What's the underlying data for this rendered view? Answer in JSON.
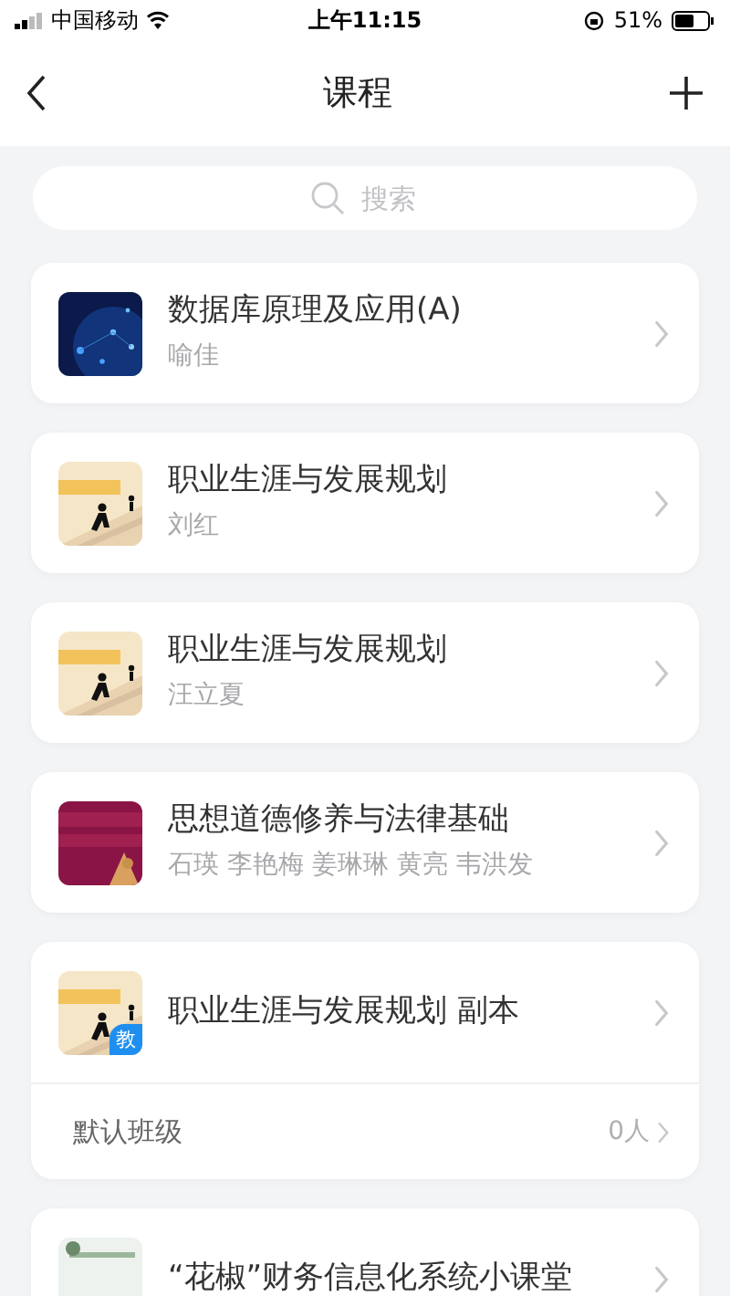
{
  "status_bar": {
    "carrier": "中国移动",
    "time": "上午11:15",
    "battery": "51%"
  },
  "nav": {
    "title": "课程"
  },
  "search": {
    "placeholder": "搜索"
  },
  "courses": [
    {
      "title": "数据库原理及应用(A)",
      "teachers": "喻佳"
    },
    {
      "title": "职业生涯与发展规划",
      "teachers": "刘红"
    },
    {
      "title": "职业生涯与发展规划",
      "teachers": "汪立夏"
    },
    {
      "title": "思想道德修养与法律基础",
      "teachers": "石瑛 李艳梅 姜琳琳 黄亮 韦洪发"
    },
    {
      "title": "职业生涯与发展规划 副本",
      "badge": "教",
      "classes": [
        {
          "name": "默认班级",
          "count": "0人"
        }
      ]
    },
    {
      "title": "“花椒”财务信息化系统小课堂"
    }
  ]
}
